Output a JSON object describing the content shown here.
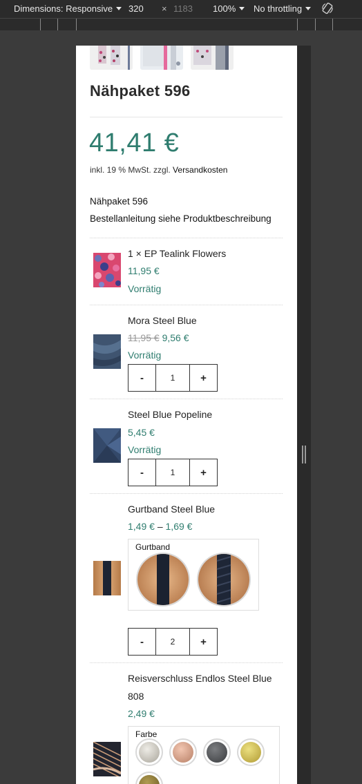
{
  "devtools": {
    "dimensions_label": "Dimensions: Responsive",
    "width_value": "320",
    "times": "×",
    "height_value": "1183",
    "zoom": "100%",
    "throttling": "No throttling"
  },
  "product": {
    "title": "Nähpaket 596",
    "price": "41,41 €",
    "tax_prefix": "inkl. 19 % MwSt. zzgl.",
    "tax_link": "Versandkosten",
    "desc_line1": "Nähpaket 596",
    "desc_line2": "Bestellanleitung siehe Produktbeschreibung"
  },
  "items": [
    {
      "name": "1 × EP Tealink Flowers",
      "price": "11,95 €",
      "stock": "Vorrätig"
    },
    {
      "name": "Mora Steel Blue",
      "old_price": "11,95 €",
      "price": "9,56 €",
      "stock": "Vorrätig",
      "qty": "1"
    },
    {
      "name": "Steel Blue Popeline",
      "price": "5,45 €",
      "stock": "Vorrätig",
      "qty": "1"
    },
    {
      "name": "Gurtband Steel Blue",
      "price_low": "1,49 €",
      "price_sep": "–",
      "price_high": "1,69 €",
      "swatch_label": "Gurtband",
      "qty": "2"
    },
    {
      "name_line1": "Reisverschluss Endlos Steel Blue",
      "name_line2": "808",
      "price": "2,49 €",
      "swatch_label": "Farbe"
    }
  ],
  "qty_controls": {
    "minus": "-",
    "plus": "+"
  },
  "colors": {
    "accent": "#2f7d6f",
    "swatch_silver": "#c9c6bf",
    "swatch_rose": "#d9a48c",
    "swatch_gunmetal": "#55575a",
    "swatch_gold": "#d4c155",
    "swatch_bronze": "#8a7632"
  }
}
